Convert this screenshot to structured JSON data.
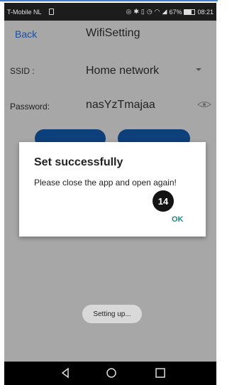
{
  "status_bar": {
    "carrier": "T-Mobile  NL",
    "icons": [
      "sim-icon",
      "nfc-icon",
      "bluetooth-icon",
      "vibrate-icon",
      "alarm-icon",
      "wifi-icon",
      "signal-icon",
      "battery-icon"
    ],
    "battery": "67%",
    "time": "08:21"
  },
  "header": {
    "back_label": "Back",
    "title": "WifiSetting"
  },
  "form": {
    "ssid_label": "SSID :",
    "ssid_value": "Home network",
    "password_label": "Password:",
    "password_value": "nasYzTmajaa"
  },
  "dialog": {
    "title": "Set successfully",
    "message": "Please close the app and open again!",
    "ok_label": "OK",
    "badge": "14"
  },
  "toast": {
    "text": "Setting up..."
  },
  "colors": {
    "accent_link": "#1d4f9a",
    "ok_button": "#1f8a86",
    "pill_buttons": "#0d3f7a"
  }
}
